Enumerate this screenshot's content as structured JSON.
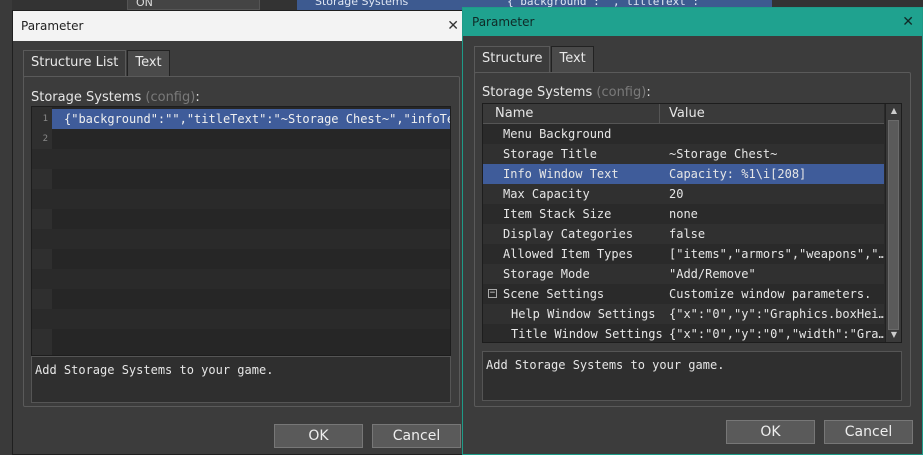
{
  "background": {
    "on_label": "ON",
    "storage_fragment": "Storage Systems",
    "code_fragment": "{\"background\":\"\",\"titleText\":"
  },
  "left_dialog": {
    "title": "Parameter",
    "tabs": [
      "Structure List",
      "Text"
    ],
    "label": "Storage Systems",
    "label_hint": "(config)",
    "label_suffix": ":",
    "lines": [
      {
        "num": "1",
        "text": "{\"background\":\"\",\"titleText\":\"~Storage Chest~\",\"infoTe…"
      },
      {
        "num": "2",
        "text": ""
      }
    ],
    "description": "Add Storage Systems to your game.",
    "ok": "OK",
    "cancel": "Cancel"
  },
  "right_dialog": {
    "title": "Parameter",
    "tabs": [
      "Structure",
      "Text"
    ],
    "label": "Storage Systems",
    "label_hint": "(config)",
    "label_suffix": ":",
    "columns": {
      "name": "Name",
      "value": "Value"
    },
    "rows": [
      {
        "name": "Menu Background",
        "value": ""
      },
      {
        "name": "Storage Title",
        "value": "~Storage Chest~"
      },
      {
        "name": "Info Window Text",
        "value": "Capacity: %1\\i[208]"
      },
      {
        "name": "Max Capacity",
        "value": "20"
      },
      {
        "name": "Item Stack Size",
        "value": "none"
      },
      {
        "name": "Display Categories",
        "value": "false"
      },
      {
        "name": "Allowed Item Types",
        "value": "[\"items\",\"armors\",\"weapons\",\"…"
      },
      {
        "name": "Storage Mode",
        "value": "\"Add/Remove\""
      },
      {
        "name": "Scene Settings",
        "value": "Customize window parameters."
      },
      {
        "name": "Help Window Settings",
        "value": "{\"x\":\"0\",\"y\":\"Graphics.boxHei…"
      },
      {
        "name": "Title Window Settings",
        "value": "{\"x\":\"0\",\"y\":\"0\",\"width\":\"Gra…"
      }
    ],
    "collapse_symbol": "−",
    "description": "Add Storage Systems to your game.",
    "ok": "OK",
    "cancel": "Cancel"
  },
  "icons": {
    "close": "close-icon",
    "scroll_up": "scroll-up-icon",
    "scroll_down": "scroll-down-icon",
    "collapse": "collapse-icon"
  },
  "colors": {
    "accent": "#1fa28f",
    "selection": "#3f5c9a"
  }
}
